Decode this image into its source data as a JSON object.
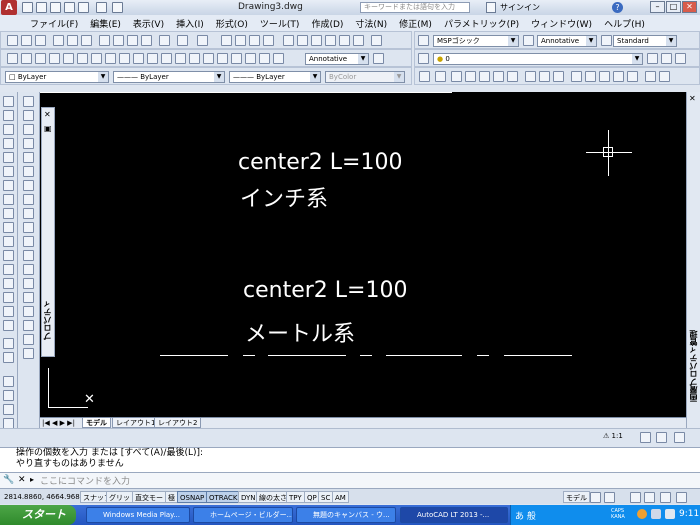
{
  "titlebar": {
    "doc_title": "Drawing3.dwg",
    "search_placeholder": "キーワードまたは語句を入力",
    "signin": "サインイン"
  },
  "menu": [
    "ファイル(F)",
    "編集(E)",
    "表示(V)",
    "挿入(I)",
    "形式(O)",
    "ツール(T)",
    "作成(D)",
    "寸法(N)",
    "修正(M)",
    "パラメトリック(P)",
    "ウィンドウ(W)",
    "ヘルプ(H)"
  ],
  "toolbar": {
    "text_style": "MSPゴシック",
    "dim_style": "Annotative",
    "table_style": "Standard",
    "multileader_style": "Annotative",
    "layer_value": "0",
    "layer": "ByLayer",
    "linetype": "ByLayer",
    "lineweight": "ByLayer",
    "color": "ByColor"
  },
  "drawing": {
    "text1": "center2  L=100",
    "text2": "インチ系",
    "text3": "center2  L=100",
    "text4": "メートル系"
  },
  "panels": {
    "properties_label": "プロパティ",
    "right_label": "画層プロパティ管理"
  },
  "tabs": [
    "モデル",
    "レイアウト1",
    "レイアウト2"
  ],
  "annotation_scale": "1:1",
  "command": {
    "history1": "操作の個数を入力 または [すべて(A)/最後(L)]:",
    "history2": "やり直すものはありません",
    "prompt_placeholder": "ここにコマンドを入力"
  },
  "status": {
    "coords": "2814.8860, 4664.9680",
    "buttons": [
      "スナップ",
      "グリッド",
      "直交モード",
      "極",
      "OSNAP",
      "OTRACK",
      "DYN",
      "線の太さ",
      "TPY",
      "QP",
      "SC",
      "AM"
    ],
    "active": [
      "OSNAP",
      "OTRACK"
    ],
    "model": "モデル"
  },
  "taskbar": {
    "start": "スタート",
    "tasks": [
      "Windows Media Play...",
      "ホームページ・ビルダー...",
      "無題のキャンバス - ウ...",
      "AutoCAD LT 2013 -..."
    ],
    "ime": "あ 般",
    "caps": "CAPS KANA",
    "time": "9:11"
  },
  "colors": {
    "canvas": "#000000",
    "taskbar": "#2456c0",
    "start": "#2f8a2c"
  }
}
